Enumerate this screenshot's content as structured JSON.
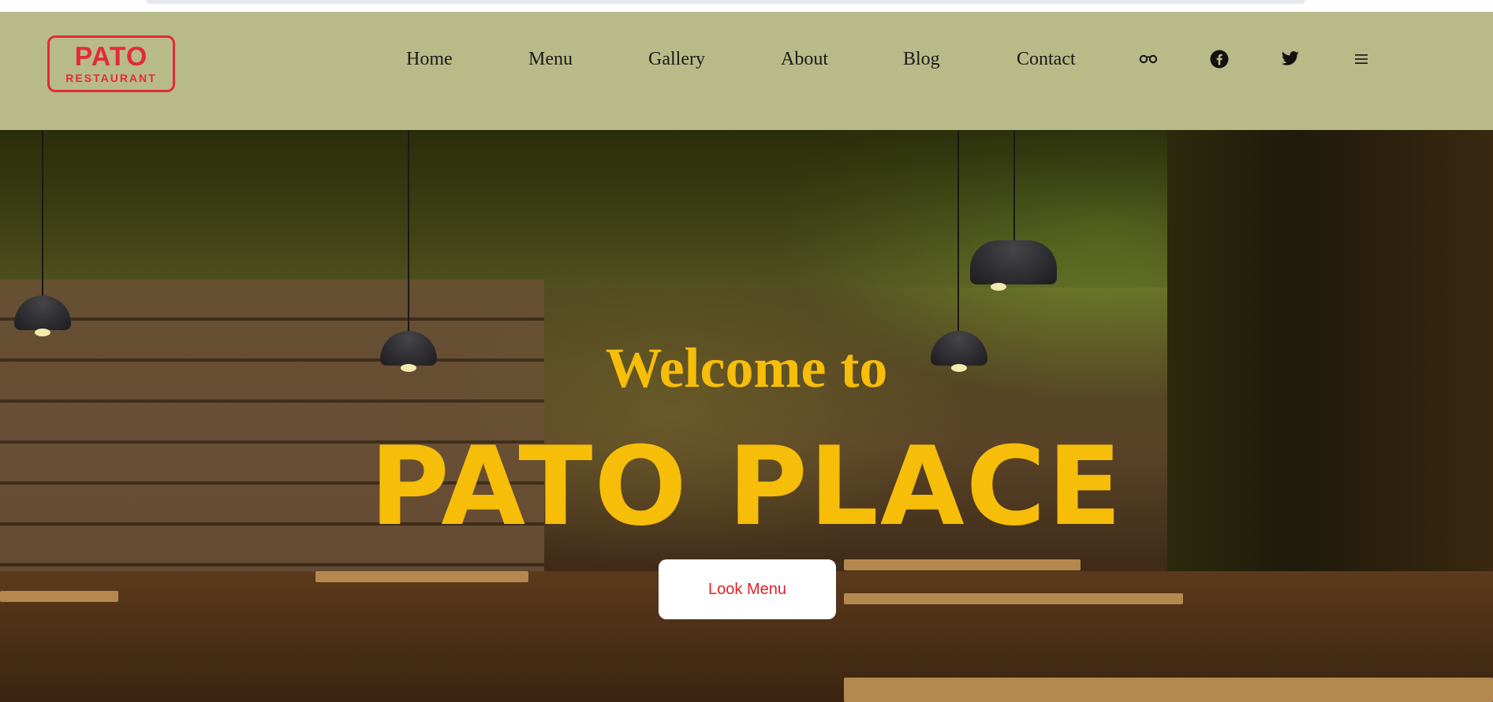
{
  "logo": {
    "line1": "PATO",
    "line2": "RESTAURANT"
  },
  "nav": {
    "items": [
      {
        "label": "Home"
      },
      {
        "label": "Menu"
      },
      {
        "label": "Gallery"
      },
      {
        "label": "About"
      },
      {
        "label": "Blog"
      },
      {
        "label": "Contact"
      }
    ],
    "icons": [
      "tripadvisor-icon",
      "facebook-icon",
      "twitter-icon",
      "hamburger-menu-icon"
    ]
  },
  "hero": {
    "welcome": "Welcome to",
    "title": "PATO PLACE",
    "cta_label": "Look Menu"
  },
  "colors": {
    "header_bg": "#b8bb88",
    "accent_yellow": "#f6bd09",
    "logo_red": "#e32a3a",
    "cta_text": "#e0202a"
  }
}
